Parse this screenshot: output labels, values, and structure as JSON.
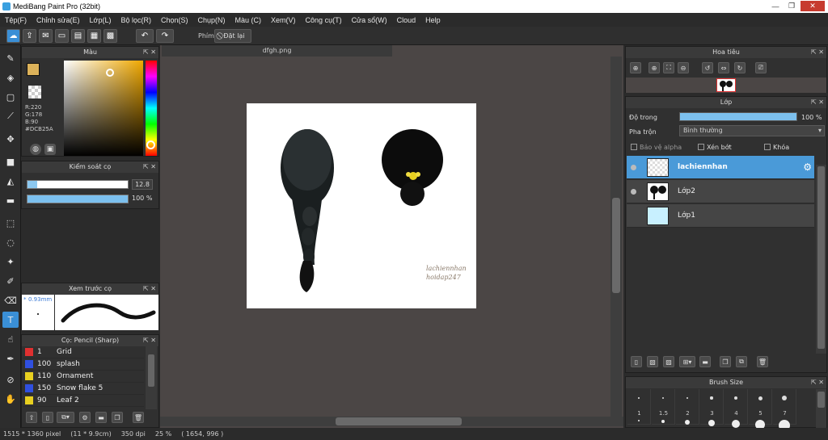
{
  "window": {
    "title": "MediBang Paint Pro (32bit)"
  },
  "menu": [
    "Tệp(F)",
    "Chỉnh sửa(E)",
    "Lớp(L)",
    "Bộ lọc(R)",
    "Chọn(S)",
    "Chụp(N)",
    "Màu (C)",
    "Xem(V)",
    "Công cụ(T)",
    "Cửa sổ(W)",
    "Cloud",
    "Help"
  ],
  "toolbar": {
    "brush_label": "Phím",
    "reset_label": "Đặt lại"
  },
  "color_panel": {
    "title": "Màu",
    "r": "R:220",
    "g": "G:178",
    "b": "B:90",
    "hex": "#DCB25A",
    "accent": "#DCB25A"
  },
  "brush_control": {
    "title": "Kiểm soát cọ",
    "size": "12.8",
    "opacity": "100 %",
    "size_fraction": 0.1,
    "opacity_fraction": 1.0
  },
  "brush_preview": {
    "title": "Xem trước cọ",
    "size": "0.93mm"
  },
  "brush_list": {
    "title": "Cọ: Pencil (Sharp)",
    "items": [
      {
        "size": "1",
        "name": "Grid",
        "color": "#e03030"
      },
      {
        "size": "100",
        "name": "splash",
        "color": "#3050e0"
      },
      {
        "size": "110",
        "name": "Ornament",
        "color": "#e8d020"
      },
      {
        "size": "150",
        "name": "Snow flake 5",
        "color": "#3050e0"
      },
      {
        "size": "90",
        "name": "Leaf 2",
        "color": "#e8d020"
      }
    ]
  },
  "document": {
    "tab": "dfgh.png",
    "watermark_line1": "lachiennhan",
    "watermark_line2": "hoidap247"
  },
  "navigator": {
    "title": "Hoa tiêu"
  },
  "layer_panel": {
    "title": "Lớp",
    "opacity_label": "Độ trong",
    "opacity_value": "100 %",
    "blend_label": "Pha trộn",
    "blend_value": "Bình thường",
    "protect_alpha": "Bảo vệ alpha",
    "clipping": "Xén bớt",
    "lock": "Khóa",
    "layers": [
      {
        "name": "lachiennhan",
        "selected": true
      },
      {
        "name": "Lớp2",
        "selected": false
      },
      {
        "name": "Lớp1",
        "selected": false
      }
    ]
  },
  "brush_size": {
    "title": "Brush Size",
    "labels": [
      "1",
      "1.5",
      "2",
      "3",
      "4",
      "5",
      "7"
    ]
  },
  "status": {
    "pixels": "1515 * 1360 pixel",
    "cm": "(11 * 9.9cm)",
    "dpi": "350 dpi",
    "zoom": "25 %",
    "coords": "( 1654, 996 )"
  }
}
